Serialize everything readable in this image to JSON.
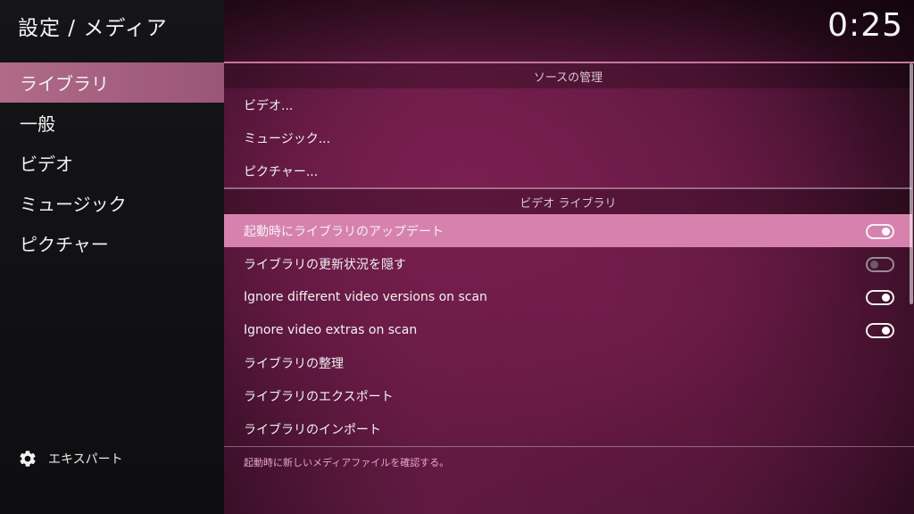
{
  "header": {
    "title": "設定 / メディア",
    "clock": "0:25"
  },
  "sidebar": {
    "items": [
      {
        "label": "ライブラリ",
        "active": true
      },
      {
        "label": "一般",
        "active": false
      },
      {
        "label": "ビデオ",
        "active": false
      },
      {
        "label": "ミュージック",
        "active": false
      },
      {
        "label": "ピクチャー",
        "active": false
      }
    ],
    "expert_label": "エキスパート",
    "expert_icon": "gear-icon"
  },
  "sources_section": {
    "title": "ソースの管理",
    "items": [
      {
        "label": "ビデオ..."
      },
      {
        "label": "ミュージック..."
      },
      {
        "label": "ピクチャー..."
      }
    ]
  },
  "video_library_section": {
    "title": "ビデオ ライブラリ",
    "items": [
      {
        "label": "起動時にライブラリのアップデート",
        "toggle": "on",
        "highlighted": true
      },
      {
        "label": "ライブラリの更新状況を隠す",
        "toggle": "off"
      },
      {
        "label": "Ignore different video versions on scan",
        "toggle": "on"
      },
      {
        "label": "Ignore video extras on scan",
        "toggle": "on"
      },
      {
        "label": "ライブラリの整理"
      },
      {
        "label": "ライブラリのエクスポート"
      },
      {
        "label": "ライブラリのインポート"
      }
    ]
  },
  "footer": {
    "description": "起動時に新しいメディアファイルを確認する。"
  },
  "colors": {
    "accent": "#d782ae",
    "sidebar_active": "#b06a8a",
    "description_text": "#e6a6c6"
  }
}
